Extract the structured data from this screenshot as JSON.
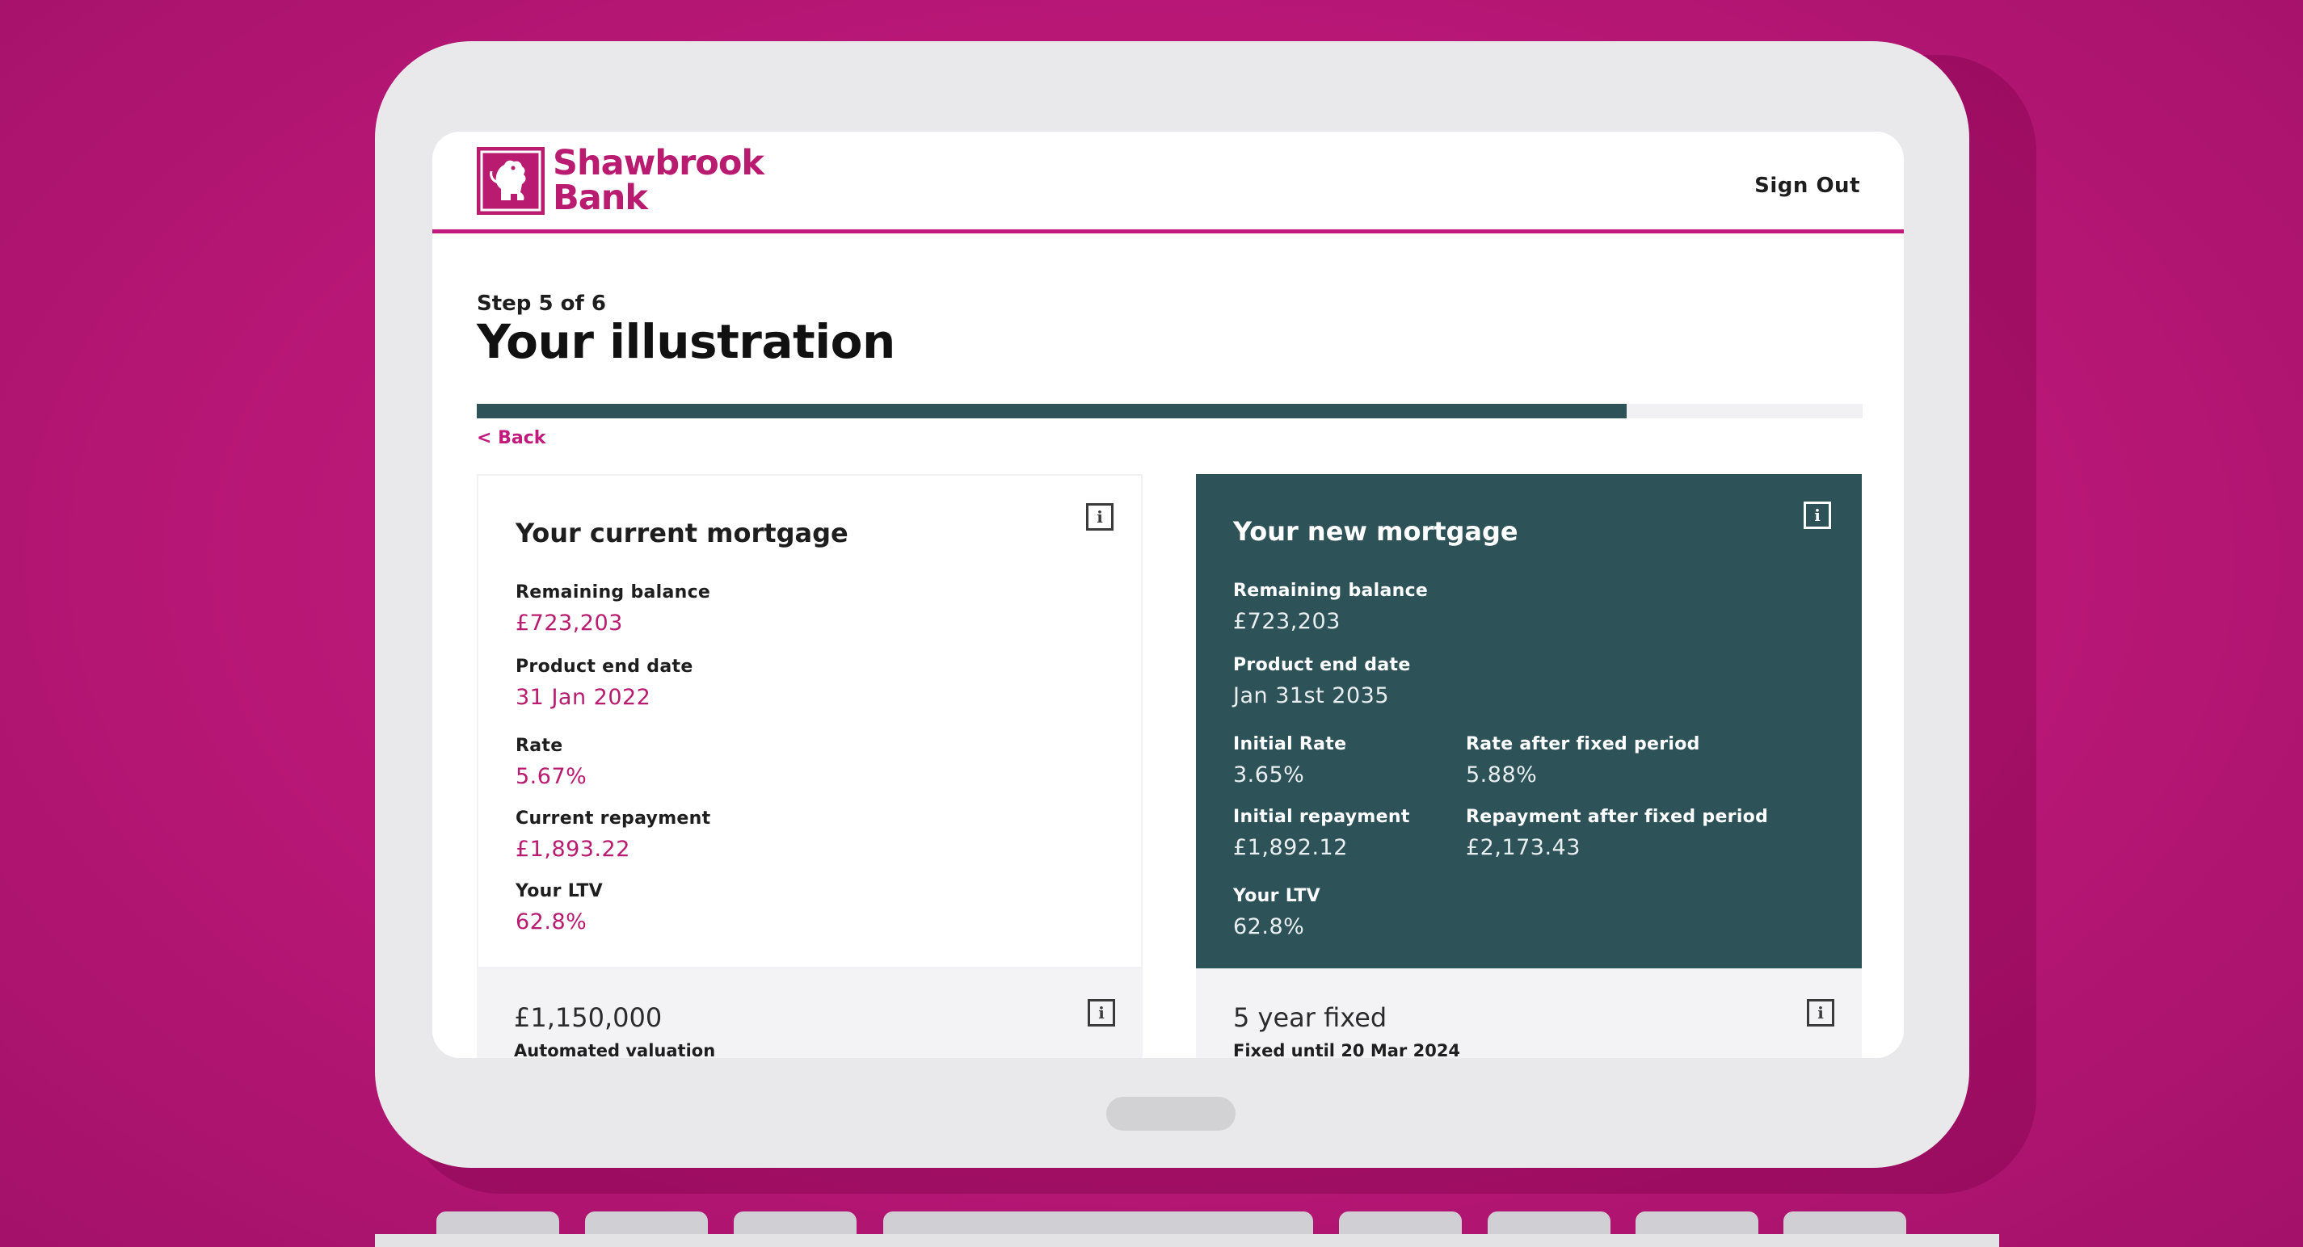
{
  "brand": {
    "name_line1": "Shawbrook",
    "name_line2": "Bank",
    "logo_icon": "lion-icon",
    "color": "#b81b6f"
  },
  "header": {
    "sign_out": "Sign Out"
  },
  "page": {
    "step": "Step 5 of 6",
    "title": "Your illustration",
    "progress": 0.83,
    "back": "< Back"
  },
  "current_mortgage": {
    "title": "Your current mortgage",
    "fields": [
      {
        "label": "Remaining balance",
        "value": "£723,203"
      },
      {
        "label": "Product end date",
        "value": "31 Jan 2022"
      },
      {
        "label": "Rate",
        "value": "5.67%"
      },
      {
        "label": "Current repayment",
        "value": "£1,893.22"
      },
      {
        "label": "Your LTV",
        "value": "62.8%"
      }
    ],
    "footer": {
      "value": "£1,150,000",
      "label": "Automated valuation"
    }
  },
  "new_mortgage": {
    "title": "Your new mortgage",
    "fields": [
      {
        "label": "Remaining balance",
        "value": "£723,203"
      },
      {
        "label": "Product end date",
        "value": "Jan 31st 2035"
      },
      {
        "label": "Initial Rate",
        "value": "3.65%"
      },
      {
        "label": "Rate after fixed period",
        "value": "5.88%"
      },
      {
        "label": "Initial repayment",
        "value": "£1,892.12"
      },
      {
        "label": "Repayment after fixed period",
        "value": "£2,173.43"
      },
      {
        "label": "Your LTV",
        "value": "62.8%"
      }
    ],
    "footer": {
      "value": "5 year fixed",
      "label": "Fixed until 20 Mar 2024"
    }
  },
  "info_icon_glyph": "i",
  "colors": {
    "accent": "#c21a7c",
    "teal": "#2d5258",
    "background": "#b81776"
  }
}
